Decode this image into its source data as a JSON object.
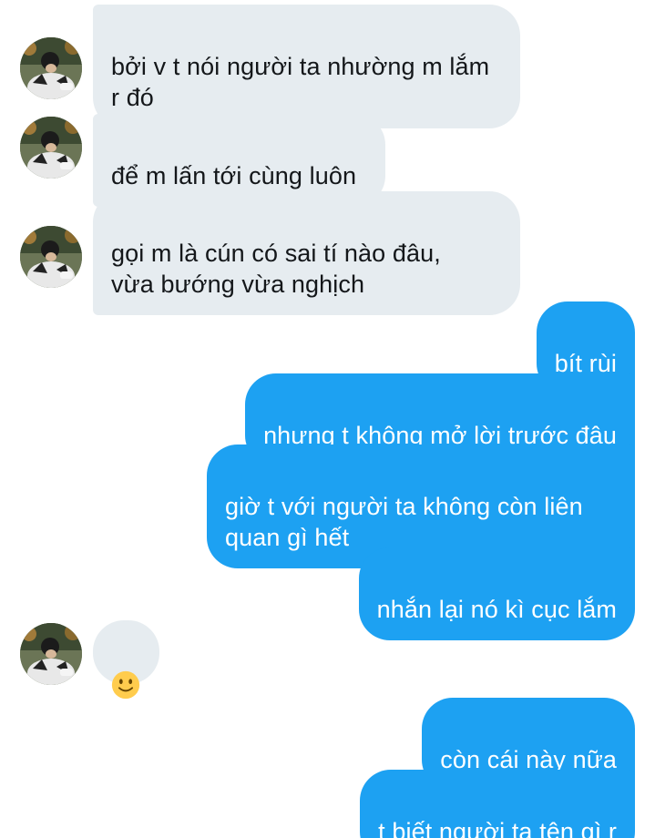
{
  "conversation": {
    "messages": [
      {
        "side": "in",
        "text": "bởi v t nói người ta nhường m lắm\nr đó"
      },
      {
        "side": "in",
        "text": "để m lấn tới cùng luôn"
      },
      {
        "side": "in",
        "text": "gọi m là cún có sai tí nào đâu,\nvừa bướng vừa nghịch"
      },
      {
        "side": "out",
        "text": "bít rùi"
      },
      {
        "side": "out",
        "text": "nhưng t không mở lời trước đâu"
      },
      {
        "side": "out",
        "text": "giờ t với người ta không còn liên\nquan gì hết"
      },
      {
        "side": "out",
        "text": "nhắn lại nó kì cục lắm"
      },
      {
        "side": "in",
        "emoji": "slightly-smiling-face"
      },
      {
        "side": "out",
        "text": "còn cái này nữa"
      },
      {
        "side": "out",
        "text": "t biết người ta tên gì r"
      }
    ]
  },
  "colors": {
    "incoming_bubble": "#e6ecf0",
    "outgoing_bubble": "#1da1f2",
    "incoming_text": "#14171a",
    "outgoing_text": "#ffffff"
  }
}
